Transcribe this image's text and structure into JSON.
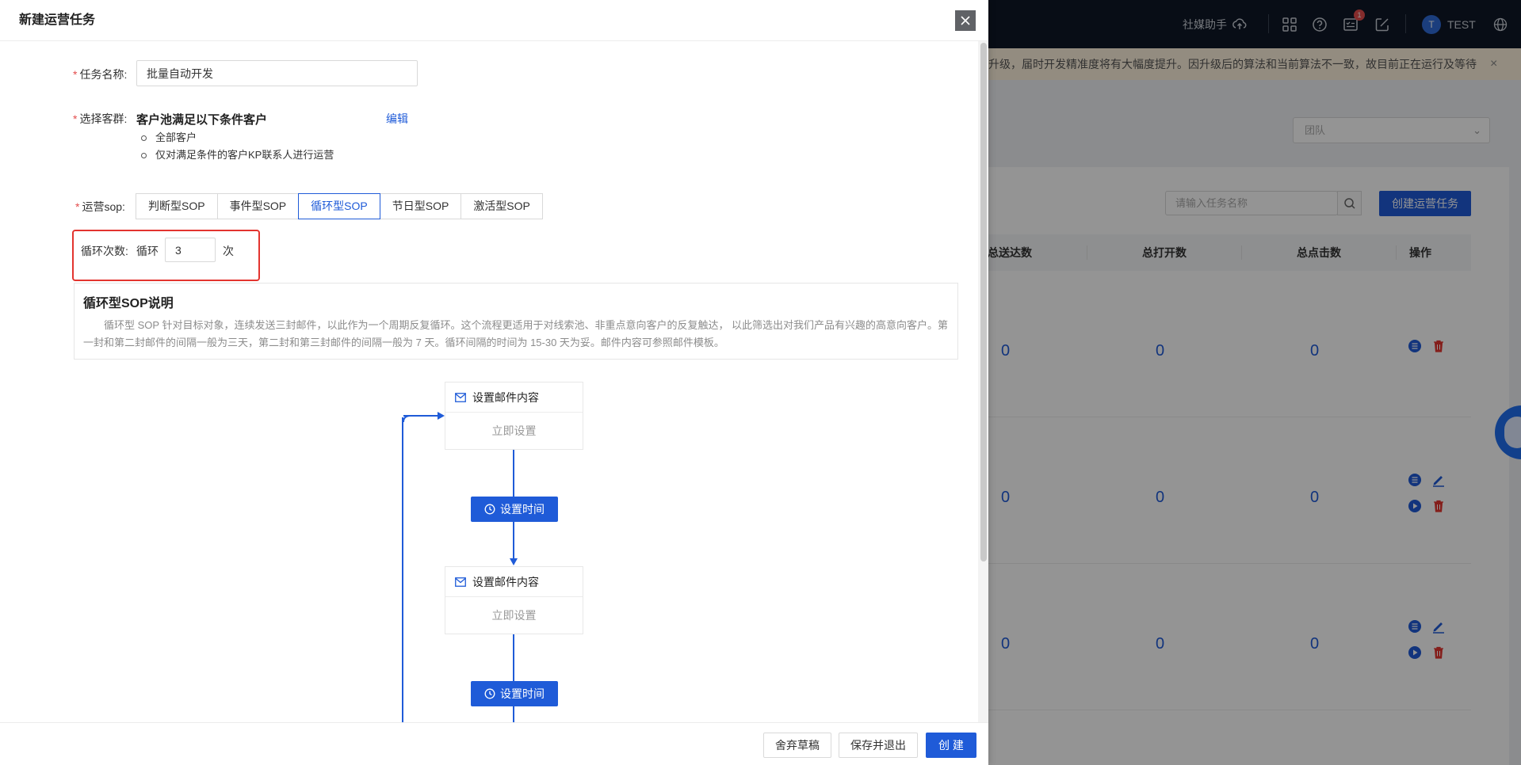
{
  "background": {
    "topbar": {
      "assistant_label": "社媒助手",
      "badge_count": "1",
      "user_initial": "T",
      "user_name": "TEST"
    },
    "notice": {
      "text": "升级，届时开发精准度将有大幅度提升。因升级后的算法和当前算法不一致，故目前正在运行及等待",
      "close": "×"
    },
    "team_select": {
      "placeholder": "团队"
    },
    "search": {
      "placeholder": "请输入任务名称"
    },
    "create_button": "创建运营任务",
    "table": {
      "headers": [
        "总送达数",
        "总打开数",
        "总点击数",
        "操作"
      ],
      "rows": [
        {
          "sent": "0",
          "opened": "0",
          "clicked": "0"
        },
        {
          "sent": "0",
          "opened": "0",
          "clicked": "0"
        },
        {
          "sent": "0",
          "opened": "0",
          "clicked": "0"
        }
      ]
    },
    "colors": {
      "topbar": "#0e1726",
      "primary": "#1f5bd8",
      "danger": "#e3342f",
      "notice_bg": "#fdf1dc"
    }
  },
  "drawer": {
    "title": "新建运营任务",
    "form": {
      "task_name": {
        "label": "任务名称:",
        "value": "批量自动开发"
      },
      "customer_group": {
        "label": "选择客群:",
        "title": "客户池满足以下条件客户",
        "edit_link": "编辑",
        "conditions": [
          "全部客户",
          "仅对满足条件的客户KP联系人进行运营"
        ]
      },
      "sop": {
        "label": "运营sop:",
        "tabs": [
          "判断型SOP",
          "事件型SOP",
          "循环型SOP",
          "节日型SOP",
          "激活型SOP"
        ],
        "active_index": 2
      },
      "loop": {
        "label": "循环次数:",
        "prefix": "循环",
        "value": "3",
        "suffix": "次"
      }
    },
    "description": {
      "title": "循环型SOP说明",
      "text": "循环型 SOP 针对目标对象，连续发送三封邮件，以此作为一个周期反复循环。这个流程更适用于对线索池、非重点意向客户的反复触达， 以此筛选出对我们产品有兴趣的高意向客户。第一封和第二封邮件的间隔一般为三天，第二封和第三封邮件的间隔一般为 7 天。循环间隔的时间为 15-30 天为妥。邮件内容可参照邮件模板。"
    },
    "flow": {
      "email_title": "设置邮件内容",
      "email_action": "立即设置",
      "time_button": "设置时间"
    },
    "footer": {
      "discard": "舍弃草稿",
      "save_exit": "保存并退出",
      "create": "创 建"
    }
  }
}
